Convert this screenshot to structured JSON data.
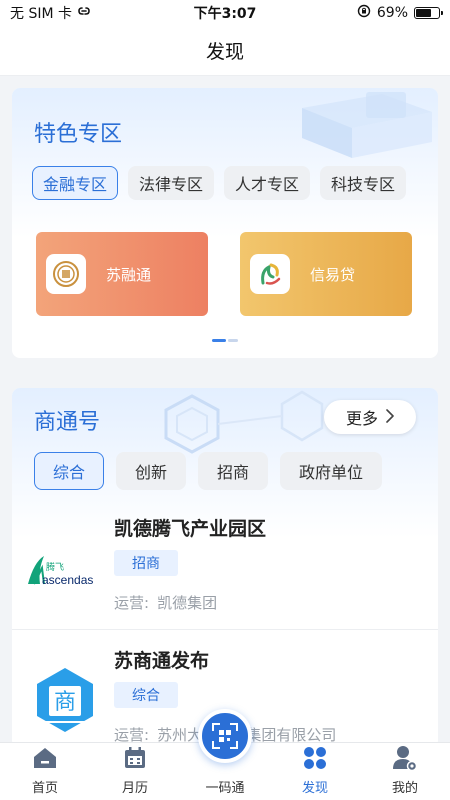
{
  "status_bar": {
    "carrier": "无 SIM 卡",
    "time": "下午3:07",
    "battery_percent": "69%",
    "battery_level": 0.69
  },
  "nav": {
    "title": "发现"
  },
  "featured": {
    "title": "特色专区",
    "chips": [
      {
        "label": "金融专区",
        "active": true
      },
      {
        "label": "法律专区",
        "active": false
      },
      {
        "label": "人才专区",
        "active": false
      },
      {
        "label": "科技专区",
        "active": false
      }
    ],
    "services": [
      {
        "label": "苏融通",
        "icon": "sronghtong-logo-icon",
        "color": "#ee8864"
      },
      {
        "label": "信易贷",
        "icon": "xinyidai-logo-icon",
        "color": "#ecb75a"
      }
    ],
    "carousel": {
      "pages": 2,
      "current": 1
    }
  },
  "business": {
    "title": "商通号",
    "more_label": "更多",
    "chips": [
      {
        "label": "综合",
        "active": true
      },
      {
        "label": "创新",
        "active": false
      },
      {
        "label": "招商",
        "active": false
      },
      {
        "label": "政府单位",
        "active": false
      }
    ],
    "items": [
      {
        "name": "凯德腾飞产业园区",
        "tag": "招商",
        "operator_label": "运营:",
        "operator": "凯德集团",
        "logo_text_top": "腾飞",
        "logo_text": "ascendas"
      },
      {
        "name": "苏商通发布",
        "tag": "综合",
        "operator_label": "运营:",
        "operator": "苏州大...控股集团有限公司",
        "logo_text": "商"
      }
    ]
  },
  "tab_bar": {
    "tabs": [
      {
        "label": "首页",
        "icon": "home-icon",
        "active": false
      },
      {
        "label": "月历",
        "icon": "calendar-icon",
        "active": false
      },
      {
        "label": "一码通",
        "icon": "qr-scan-icon",
        "active": false
      },
      {
        "label": "发现",
        "icon": "discover-icon",
        "active": true
      },
      {
        "label": "我的",
        "icon": "profile-icon",
        "active": false
      }
    ]
  },
  "colors": {
    "accent": "#2b6fd6",
    "chip_active_bg": "#e8f1ff",
    "background": "#f2f4f7"
  }
}
